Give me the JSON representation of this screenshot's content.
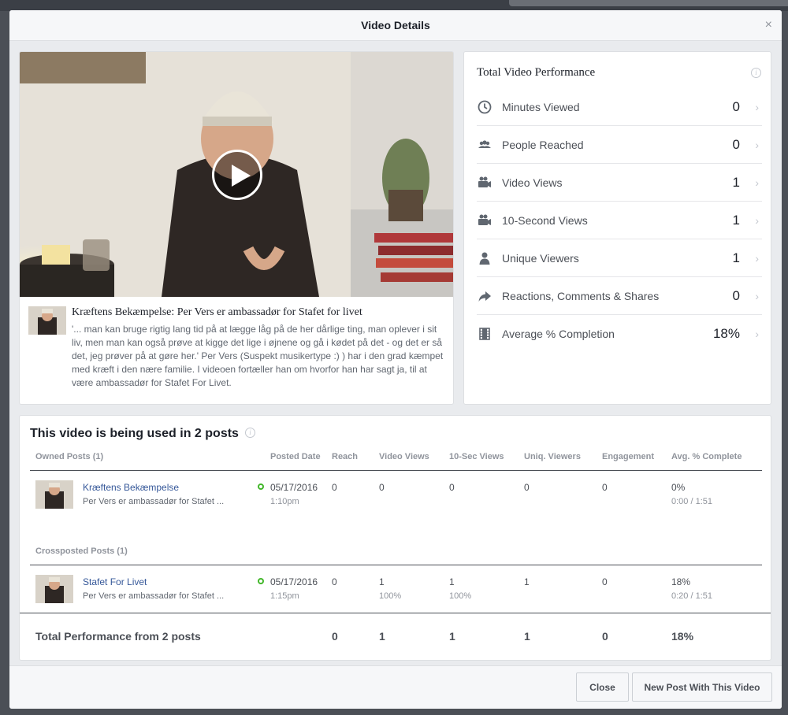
{
  "dialog": {
    "title": "Video Details",
    "close_glyph": "×"
  },
  "video": {
    "title": "Kræftens Bekæmpelse: Per Vers er ambassadør for Stafet for livet",
    "description": "'... man kan bruge rigtig lang tid på at lægge låg på de her dårlige ting, man oplever i sit liv, men man kan også prøve at kigge det lige i øjnene og gå i kødet på det - og det er så det, jeg prøver på at gøre her.' Per Vers (Suspekt musikertype :) ) har i den grad kæmpet med kræft i den nære familie. I videoen fortæller han om hvorfor han har sagt ja, til at være ambassadør for Stafet For Livet."
  },
  "performance": {
    "title": "Total Video Performance",
    "rows": [
      {
        "icon": "clock-icon",
        "label": "Minutes Viewed",
        "value": "0"
      },
      {
        "icon": "people-icon",
        "label": "People Reached",
        "value": "0"
      },
      {
        "icon": "video-camera-icon",
        "label": "Video Views",
        "value": "1"
      },
      {
        "icon": "video-camera-icon",
        "label": "10-Second Views",
        "value": "1"
      },
      {
        "icon": "person-icon",
        "label": "Unique Viewers",
        "value": "1"
      },
      {
        "icon": "share-arrow-icon",
        "label": "Reactions, Comments & Shares",
        "value": "0"
      },
      {
        "icon": "film-icon",
        "label": "Average % Completion",
        "value": "18%"
      }
    ]
  },
  "posts": {
    "title": "This video is being used in 2 posts",
    "columns": {
      "owned": "Owned Posts (1)",
      "posted_date": "Posted Date",
      "reach": "Reach",
      "video_views": "Video Views",
      "ten_sec_views": "10-Sec Views",
      "uniq_viewers": "Uniq. Viewers",
      "engagement": "Engagement",
      "avg_complete": "Avg. % Complete"
    },
    "owned": {
      "name": "Kræftens Bekæmpelse",
      "subtitle": "Per Vers er ambassadør for Stafet ...",
      "date": "05/17/2016",
      "time": "1:10pm",
      "reach": "0",
      "video_views": "0",
      "ten_sec_views": "0",
      "uniq_viewers": "0",
      "engagement": "0",
      "avg_complete": "0%",
      "avg_complete_time": "0:00 / 1:51"
    },
    "crossposted_label": "Crossposted Posts (1)",
    "crossposted": {
      "name": "Stafet For Livet",
      "subtitle": "Per Vers er ambassadør for Stafet ...",
      "date": "05/17/2016",
      "time": "1:15pm",
      "reach": "0",
      "video_views": "1",
      "video_views_pct": "100%",
      "ten_sec_views": "1",
      "ten_sec_views_pct": "100%",
      "uniq_viewers": "1",
      "engagement": "0",
      "avg_complete": "18%",
      "avg_complete_time": "0:20 / 1:51"
    },
    "total": {
      "label": "Total Performance from 2 posts",
      "reach": "0",
      "video_views": "1",
      "ten_sec_views": "1",
      "uniq_viewers": "1",
      "engagement": "0",
      "avg_complete": "18%"
    }
  },
  "footer": {
    "close_label": "Close",
    "new_post_label": "New Post With This Video"
  },
  "colors": {
    "link": "#365899",
    "status_green": "#42b72a",
    "icon_grey": "#606770"
  }
}
